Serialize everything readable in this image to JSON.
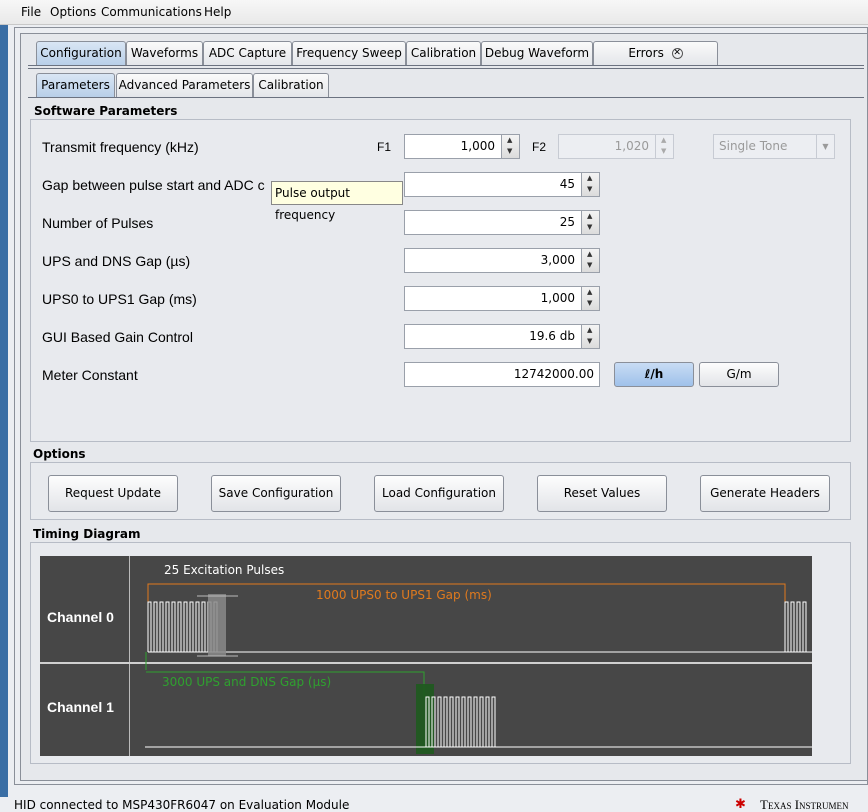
{
  "menu": [
    "File",
    "Options",
    "Communications",
    "Help"
  ],
  "tabs": [
    "Configuration",
    "Waveforms",
    "ADC Capture",
    "Frequency Sweep",
    "Calibration",
    "Debug Waveform",
    "Errors"
  ],
  "subtabs": [
    "Parameters",
    "Advanced Parameters",
    "Calibration"
  ],
  "software_params": {
    "title": "Software Parameters",
    "transmit_freq_label": "Transmit frequency (kHz)",
    "f1_label": "F1",
    "f1_value": "1,000",
    "f2_label": "F2",
    "f2_value": "1,020",
    "tone_select": "Single Tone",
    "gap_label": "Gap between pulse start and ADC c",
    "gap_value": "45",
    "pulses_label": "Number of Pulses",
    "pulses_value": "25",
    "ups_dns_label": "UPS and DNS Gap (µs)",
    "ups_dns_value": "3,000",
    "ups0_ups1_label": "UPS0 to UPS1 Gap (ms)",
    "ups0_ups1_value": "1,000",
    "gain_label": "GUI Based Gain Control",
    "gain_value": "19.6 db",
    "meter_label": "Meter Constant",
    "meter_value": "12742000.00",
    "unit_lh": "ℓ/h",
    "unit_gm": "G/m"
  },
  "tooltip": "Pulse output frequency",
  "options": {
    "title": "Options",
    "buttons": [
      "Request Update",
      "Save Configuration",
      "Load Configuration",
      "Reset Values",
      "Generate Headers"
    ]
  },
  "timing": {
    "title": "Timing Diagram",
    "channel0": "Channel 0",
    "channel1": "Channel 1",
    "excitation": "25 Excitation Pulses",
    "ups0_gap": "1000 UPS0 to UPS1 Gap (ms)",
    "ups_dns_gap": "3000 UPS and DNS Gap (µs)"
  },
  "status": "HID connected to MSP430FR6047 on Evaluation Module",
  "brand": "Texas Instrumen",
  "colors": {
    "orange": "#e07a1e",
    "green": "#2fa02f",
    "tab_sel": "#b8cfe8"
  }
}
